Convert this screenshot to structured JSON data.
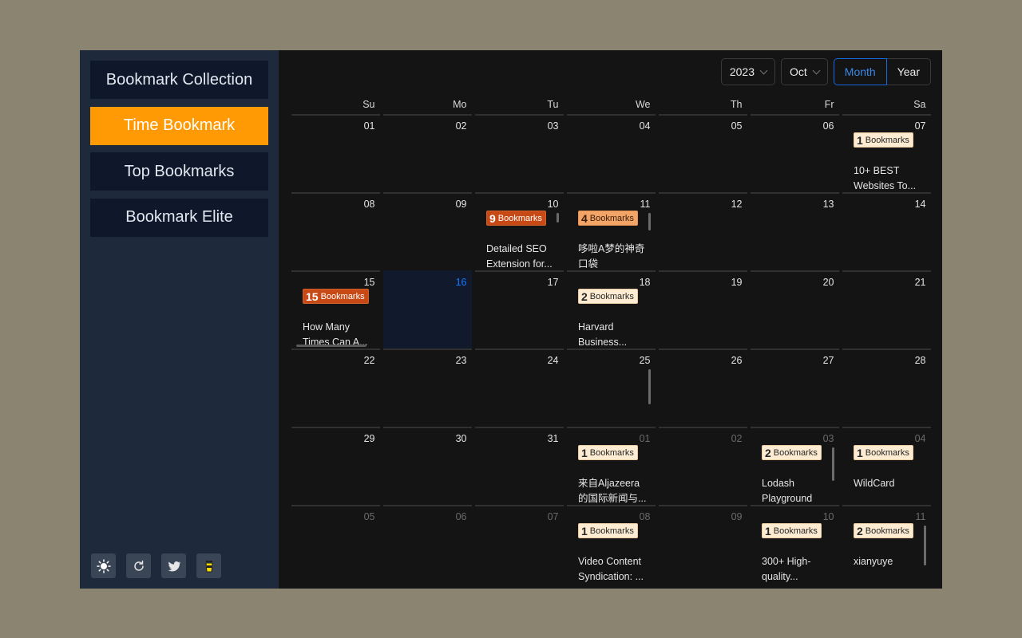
{
  "sidebar": {
    "items": [
      {
        "label": "Bookmark Collection",
        "active": false
      },
      {
        "label": "Time Bookmark",
        "active": true
      },
      {
        "label": "Top Bookmarks",
        "active": false
      },
      {
        "label": "Bookmark Elite",
        "active": false
      }
    ],
    "tools": [
      {
        "icon": "sun-icon"
      },
      {
        "icon": "refresh-icon"
      },
      {
        "icon": "twitter-icon"
      },
      {
        "icon": "coffee-cup-icon"
      }
    ]
  },
  "toolbar": {
    "year": "2023",
    "month": "Oct",
    "view_month": "Month",
    "view_year": "Year",
    "accent": "#1668dc"
  },
  "calendar": {
    "weekdays": [
      "Su",
      "Mo",
      "Tu",
      "We",
      "Th",
      "Fr",
      "Sa"
    ],
    "today": "16",
    "unit_label": "Bookmarks",
    "weeks": [
      [
        {
          "d": "01"
        },
        {
          "d": "02"
        },
        {
          "d": "03"
        },
        {
          "d": "04"
        },
        {
          "d": "05"
        },
        {
          "d": "06"
        },
        {
          "d": "07",
          "count": "1",
          "title": "10+ BEST Websites To..."
        }
      ],
      [
        {
          "d": "08"
        },
        {
          "d": "09"
        },
        {
          "d": "10",
          "count": "9",
          "level": "high",
          "title": "Detailed SEO Extension for..."
        },
        {
          "d": "11",
          "count": "4",
          "level": "mid",
          "title": "哆啦A梦的神奇口袋"
        },
        {
          "d": "12"
        },
        {
          "d": "13"
        },
        {
          "d": "14"
        }
      ],
      [
        {
          "d": "15",
          "count": "15",
          "level": "high",
          "title": "How Many Times Can A..."
        },
        {
          "d": "16",
          "today": true
        },
        {
          "d": "17"
        },
        {
          "d": "18",
          "count": "2",
          "title": "Harvard Business..."
        },
        {
          "d": "19"
        },
        {
          "d": "20"
        },
        {
          "d": "21"
        }
      ],
      [
        {
          "d": "22"
        },
        {
          "d": "23"
        },
        {
          "d": "24"
        },
        {
          "d": "25"
        },
        {
          "d": "26"
        },
        {
          "d": "27"
        },
        {
          "d": "28"
        }
      ],
      [
        {
          "d": "29"
        },
        {
          "d": "30"
        },
        {
          "d": "31"
        },
        {
          "d": "01",
          "other": true,
          "count": "1",
          "title": "来自Aljazeera的国际新闻与..."
        },
        {
          "d": "02",
          "other": true
        },
        {
          "d": "03",
          "other": true,
          "count": "2",
          "title": "Lodash Playground"
        },
        {
          "d": "04",
          "other": true,
          "count": "1",
          "title": "WildCard"
        }
      ],
      [
        {
          "d": "05",
          "other": true
        },
        {
          "d": "06",
          "other": true
        },
        {
          "d": "07",
          "other": true
        },
        {
          "d": "08",
          "other": true,
          "count": "1",
          "title": "Video Content Syndication: ..."
        },
        {
          "d": "09",
          "other": true
        },
        {
          "d": "10",
          "other": true,
          "count": "1",
          "title": "300+ High-quality..."
        },
        {
          "d": "11",
          "other": true,
          "count": "2",
          "title": "xianyuye"
        }
      ]
    ]
  }
}
